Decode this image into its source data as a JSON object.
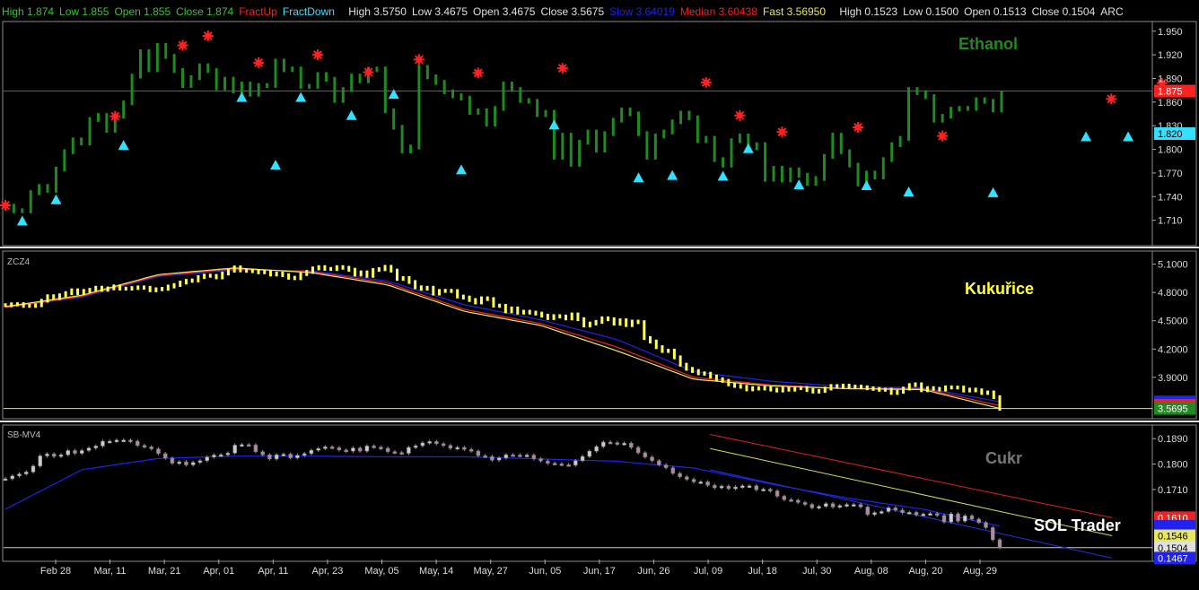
{
  "header": {
    "ethanol": [
      {
        "text": "High 1.874",
        "color": "#3fbf3f"
      },
      {
        "text": "Low 1.855",
        "color": "#3fbf3f"
      },
      {
        "text": "Open 1.855",
        "color": "#3fbf3f"
      },
      {
        "text": "Close 1.874",
        "color": "#3fbf3f"
      },
      {
        "text": "FractUp",
        "color": "#ff2020"
      },
      {
        "text": "FractDown",
        "color": "#3fe0ff"
      }
    ],
    "corn": [
      {
        "text": "High 3.5750",
        "color": "#e0e0e0"
      },
      {
        "text": "Low 3.4675",
        "color": "#e0e0e0"
      },
      {
        "text": "Open 3.4675",
        "color": "#e0e0e0"
      },
      {
        "text": "Close 3.5675",
        "color": "#e0e0e0"
      },
      {
        "text": "Slow 3.64019",
        "color": "#2222ee"
      },
      {
        "text": "Median 3.60438",
        "color": "#ee2222"
      },
      {
        "text": "Fast 3.56950",
        "color": "#e8e860"
      }
    ],
    "sugar": [
      {
        "text": "High 0.1523",
        "color": "#e0e0e0"
      },
      {
        "text": "Low 0.1500",
        "color": "#e0e0e0"
      },
      {
        "text": "Open 0.1513",
        "color": "#e0e0e0"
      },
      {
        "text": "Close 0.1504",
        "color": "#e0e0e0"
      },
      {
        "text": "ARC",
        "color": "#e0e0e0"
      }
    ]
  },
  "watermark": "SOL Trader",
  "x_axis_labels": [
    "Feb 28",
    "Mar, 11",
    "Mar, 21",
    "Apr, 01",
    "Apr, 11",
    "Apr, 23",
    "May, 05",
    "May, 14",
    "May, 27",
    "Jun, 05",
    "Jun, 17",
    "Jun, 26",
    "Jul, 09",
    "Jul, 18",
    "Jul, 30",
    "Aug, 08",
    "Aug, 20",
    "Aug, 29"
  ],
  "colors": {
    "ethanol": "#1f8a1f",
    "corn": "#ffff55",
    "sugar_candle": "#bbbbbb",
    "fractal_up": "#ff2020",
    "fractal_down": "#33e0ff",
    "slow_ma": "#2222ee",
    "median_ma": "#ee2222",
    "fast_ma": "#e8e860",
    "axis_line": "#d0d0d0"
  },
  "chart_data": [
    {
      "type": "bar",
      "panel": "ethanol",
      "title": "Ethanol",
      "ylim": [
        1.68,
        1.96
      ],
      "y_ticks": [
        "1.950",
        "1.920",
        "1.890",
        "1.860",
        "1.830",
        "1.800",
        "1.770",
        "1.740",
        "1.710"
      ],
      "reference_line": 1.874,
      "price_tags": [
        {
          "value": "1.874",
          "label": "1.875",
          "color": "#ff2020"
        },
        {
          "value": "1.820",
          "label": "1.820",
          "color": "#33e0ff"
        }
      ],
      "closes": [
        1.728,
        1.722,
        1.722,
        1.745,
        1.753,
        1.748,
        1.775,
        1.797,
        1.812,
        1.808,
        1.838,
        1.843,
        1.824,
        1.842,
        1.859,
        1.893,
        1.924,
        1.901,
        1.932,
        1.918,
        1.9,
        1.881,
        1.891,
        1.906,
        1.9,
        1.878,
        1.889,
        1.874,
        1.883,
        1.87,
        1.881,
        1.881,
        1.912,
        1.901,
        1.902,
        1.88,
        1.88,
        1.895,
        1.889,
        1.862,
        1.876,
        1.893,
        1.887,
        1.901,
        1.902,
        1.849,
        1.828,
        1.798,
        1.803,
        1.904,
        1.892,
        1.885,
        1.873,
        1.868,
        1.865,
        1.847,
        1.849,
        1.832,
        1.852,
        1.883,
        1.876,
        1.862,
        1.861,
        1.844,
        1.847,
        1.79,
        1.818,
        1.781,
        1.809,
        1.822,
        1.799,
        1.82,
        1.837,
        1.85,
        1.845,
        1.82,
        1.79,
        1.817,
        1.822,
        1.835,
        1.846,
        1.84,
        1.811,
        1.814,
        1.787,
        1.78,
        1.811,
        1.817,
        1.802,
        1.806,
        1.762,
        1.776,
        1.761,
        1.774,
        1.767,
        1.757,
        1.763,
        1.791,
        1.818,
        1.797,
        1.78,
        1.756,
        1.77,
        1.765,
        1.787,
        1.806,
        1.814,
        1.876,
        1.872,
        1.867,
        1.837,
        1.842,
        1.851,
        1.852,
        1.852,
        1.863,
        1.861,
        1.85,
        1.871
      ],
      "fractal_up": [
        {
          "i": 0,
          "v": 1.729
        },
        {
          "i": 13,
          "v": 1.842
        },
        {
          "i": 21,
          "v": 1.932
        },
        {
          "i": 24,
          "v": 1.944
        },
        {
          "i": 30,
          "v": 1.91
        },
        {
          "i": 37,
          "v": 1.92
        },
        {
          "i": 43,
          "v": 1.898
        },
        {
          "i": 49,
          "v": 1.914
        },
        {
          "i": 56,
          "v": 1.897
        },
        {
          "i": 66,
          "v": 1.903
        },
        {
          "i": 83,
          "v": 1.885
        },
        {
          "i": 87,
          "v": 1.843
        },
        {
          "i": 92,
          "v": 1.822
        },
        {
          "i": 101,
          "v": 1.828
        },
        {
          "i": 111,
          "v": 1.817
        },
        {
          "i": 131,
          "v": 1.864
        },
        {
          "i": 137,
          "v": 1.884
        }
      ],
      "fractal_down": [
        {
          "i": 2,
          "v": 1.709
        },
        {
          "i": 6,
          "v": 1.736
        },
        {
          "i": 14,
          "v": 1.805
        },
        {
          "i": 28,
          "v": 1.866
        },
        {
          "i": 32,
          "v": 1.78
        },
        {
          "i": 35,
          "v": 1.866
        },
        {
          "i": 41,
          "v": 1.843
        },
        {
          "i": 46,
          "v": 1.87
        },
        {
          "i": 54,
          "v": 1.774
        },
        {
          "i": 65,
          "v": 1.831
        },
        {
          "i": 75,
          "v": 1.764
        },
        {
          "i": 79,
          "v": 1.767
        },
        {
          "i": 85,
          "v": 1.766
        },
        {
          "i": 88,
          "v": 1.801
        },
        {
          "i": 94,
          "v": 1.755
        },
        {
          "i": 102,
          "v": 1.754
        },
        {
          "i": 107,
          "v": 1.746
        },
        {
          "i": 117,
          "v": 1.745
        },
        {
          "i": 128,
          "v": 1.816
        },
        {
          "i": 133,
          "v": 1.816
        }
      ]
    },
    {
      "type": "bar",
      "panel": "corn",
      "title": "Kukuřice",
      "symbol": "ZCZ4",
      "ylim": [
        3.48,
        5.22
      ],
      "y_ticks": [
        "5.1000",
        "4.8000",
        "4.5000",
        "4.2000",
        "3.9000"
      ],
      "reference_line": 3.5695,
      "price_tags": [
        {
          "value": "3.6402",
          "label": "",
          "color": "#2222ee"
        },
        {
          "value": "3.6044",
          "label": "",
          "color": "#ee2222"
        },
        {
          "value": "3.5695",
          "label": "3.5695",
          "color": "#1f8a1f"
        }
      ],
      "closes": [
        4.665,
        4.674,
        4.676,
        4.658,
        4.658,
        4.665,
        4.712,
        4.76,
        4.74,
        4.77,
        4.793,
        4.823,
        4.792,
        4.817,
        4.828,
        4.85,
        4.828,
        4.843,
        4.865,
        4.841,
        4.841,
        4.847,
        4.854,
        4.85,
        4.823,
        4.834,
        4.839,
        4.863,
        4.879,
        4.905,
        4.923,
        4.928,
        4.963,
        4.979,
        4.976,
        4.96,
        5.001,
        5.031,
        5.066,
        5.034,
        5.029,
        5.026,
        5.014,
        5.02,
        4.99,
        5.001,
        4.983,
        4.956,
        4.951,
        4.995,
        5.018,
        5.055,
        5.069,
        5.05,
        5.048,
        5.069,
        5.062,
        5.041,
        4.99,
        5.013,
        4.976,
        5.039,
        5.047,
        5.072,
        5.032,
        4.944,
        4.953,
        4.911,
        4.855,
        4.839,
        4.85,
        4.788,
        4.816,
        4.818,
        4.815,
        4.757,
        4.746,
        4.72,
        4.694,
        4.738,
        4.73,
        4.661,
        4.658,
        4.6,
        4.631,
        4.586,
        4.596,
        4.586,
        4.576,
        4.554,
        4.528,
        4.549,
        4.545,
        4.525,
        4.567,
        4.517,
        4.45,
        4.471,
        4.488,
        4.526,
        4.516,
        4.469,
        4.505,
        4.454,
        4.491,
        4.485,
        4.317,
        4.28,
        4.22,
        4.179,
        4.183,
        4.112,
        4.034,
        3.99,
        3.967,
        3.943,
        3.938,
        3.908,
        3.88,
        3.863,
        3.826,
        3.809,
        3.8,
        3.772,
        3.786,
        3.781,
        3.789,
        3.77,
        3.76,
        3.782,
        3.769,
        3.786,
        3.788,
        3.765,
        3.749,
        3.756,
        3.781,
        3.808,
        3.799,
        3.812,
        3.803,
        3.801,
        3.795,
        3.784,
        3.777,
        3.768,
        3.769,
        3.734,
        3.747,
        3.781,
        3.818,
        3.826,
        3.763,
        3.786,
        3.778,
        3.77,
        3.794,
        3.792,
        3.792,
        3.76,
        3.77,
        3.762,
        3.734,
        3.74,
        3.69,
        3.567
      ],
      "ma_slow": {
        "start": 4.64,
        "mid": [
          4.75,
          4.97,
          5.04,
          5.03,
          4.92,
          4.67,
          4.51,
          4.3,
          3.96,
          3.86,
          3.8,
          3.79
        ],
        "end": 3.64
      },
      "ma_median": {
        "start": 4.64,
        "mid": [
          4.76,
          4.98,
          5.05,
          5.02,
          4.9,
          4.62,
          4.47,
          4.22,
          3.9,
          3.82,
          3.78,
          3.78
        ],
        "end": 3.6
      },
      "ma_fast": {
        "start": 4.65,
        "mid": [
          4.77,
          4.99,
          5.06,
          5.01,
          4.88,
          4.6,
          4.45,
          4.18,
          3.88,
          3.81,
          3.78,
          3.77
        ],
        "end": 3.57
      }
    },
    {
      "type": "bar",
      "panel": "sugar",
      "title": "Cukr",
      "symbol": "SB-MV4",
      "ylim": [
        0.1462,
        0.1932
      ],
      "y_ticks": [
        "0.1890",
        "0.1800",
        "0.1710"
      ],
      "reference_line": 0.1504,
      "price_tags": [
        {
          "value": "0.1610",
          "label": "0.1610",
          "color": "#ee2222"
        },
        {
          "value": "0.1580",
          "label": "",
          "color": "#2222ee"
        },
        {
          "value": "0.1546",
          "label": "0.1546",
          "color": "#e8e860"
        },
        {
          "value": "0.1504",
          "label": "0.1504",
          "color": "#e0e0e0"
        },
        {
          "value": "0.1467",
          "label": "0.1467",
          "color": "#2222ee"
        }
      ],
      "closes": [
        0.1748,
        0.1758,
        0.1765,
        0.1772,
        0.1793,
        0.1829,
        0.1836,
        0.1827,
        0.1833,
        0.1848,
        0.1838,
        0.1848,
        0.1857,
        0.1864,
        0.1881,
        0.1881,
        0.1885,
        0.1885,
        0.1881,
        0.1866,
        0.1861,
        0.1854,
        0.1837,
        0.1821,
        0.1803,
        0.1808,
        0.1797,
        0.1806,
        0.1812,
        0.1825,
        0.1832,
        0.1833,
        0.1839,
        0.1867,
        0.1869,
        0.1868,
        0.1844,
        0.1833,
        0.1818,
        0.1833,
        0.1835,
        0.1822,
        0.1831,
        0.1837,
        0.1849,
        0.1855,
        0.1861,
        0.1858,
        0.185,
        0.1846,
        0.1857,
        0.1846,
        0.1864,
        0.186,
        0.1856,
        0.1844,
        0.1841,
        0.1838,
        0.1859,
        0.1865,
        0.1875,
        0.188,
        0.1872,
        0.1866,
        0.1856,
        0.1859,
        0.1852,
        0.1846,
        0.183,
        0.1827,
        0.1814,
        0.1822,
        0.1833,
        0.1832,
        0.183,
        0.1832,
        0.1819,
        0.1811,
        0.1803,
        0.1801,
        0.1798,
        0.1796,
        0.1812,
        0.1827,
        0.1846,
        0.1862,
        0.1878,
        0.1876,
        0.1871,
        0.1874,
        0.1859,
        0.184,
        0.1825,
        0.1812,
        0.1797,
        0.1787,
        0.1767,
        0.1755,
        0.1746,
        0.1737,
        0.1737,
        0.1725,
        0.1716,
        0.1722,
        0.1713,
        0.1719,
        0.1723,
        0.1723,
        0.1709,
        0.1711,
        0.1705,
        0.1686,
        0.1674,
        0.1672,
        0.1664,
        0.1657,
        0.1645,
        0.165,
        0.166,
        0.1648,
        0.1653,
        0.1657,
        0.1657,
        0.1648,
        0.1621,
        0.1628,
        0.1632,
        0.1645,
        0.1637,
        0.1628,
        0.1629,
        0.162,
        0.1623,
        0.1625,
        0.1618,
        0.1595,
        0.1624,
        0.1598,
        0.1617,
        0.1605,
        0.1593,
        0.1575,
        0.1532,
        0.1504
      ],
      "ma_blue_long": {
        "start": 0.164,
        "mid": [
          0.178,
          0.182,
          0.1828,
          0.1828,
          0.1826,
          0.1826,
          0.1818,
          0.181,
          0.1786,
          0.173,
          0.168,
          0.164
        ],
        "end": 0.158
      },
      "channel_upper": {
        "x0": 0.615,
        "y0": 0.1905,
        "x1": 0.965,
        "y1": 0.161
      },
      "channel_mid": {
        "x0": 0.615,
        "y0": 0.1855,
        "x1": 0.965,
        "y1": 0.1546
      },
      "channel_lower": {
        "x0": 0.615,
        "y0": 0.178,
        "x1": 0.965,
        "y1": 0.1467
      }
    }
  ]
}
